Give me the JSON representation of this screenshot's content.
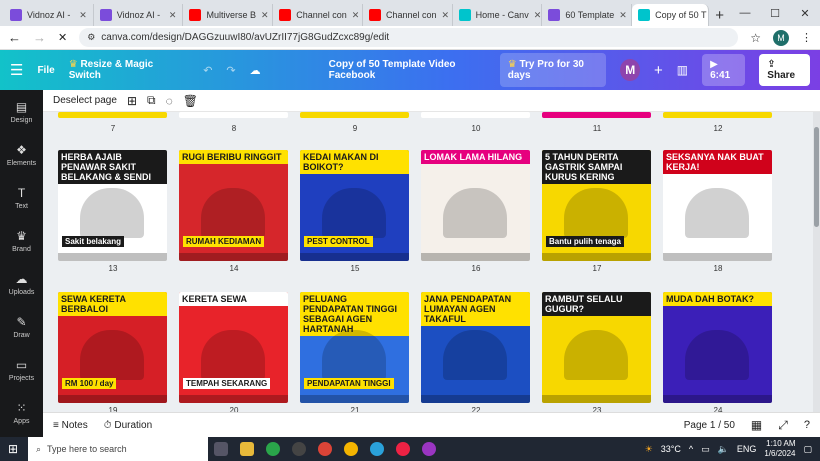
{
  "browser": {
    "tabs": [
      {
        "label": "Vidnoz AI -",
        "color": "#7b4cdb"
      },
      {
        "label": "Vidnoz AI -",
        "color": "#7b4cdb"
      },
      {
        "label": "Multiverse B",
        "color": "#ff0000"
      },
      {
        "label": "Channel con",
        "color": "#ff0000"
      },
      {
        "label": "Channel con",
        "color": "#ff0000"
      },
      {
        "label": "Home - Canv",
        "color": "#00c4cc"
      },
      {
        "label": "60 Template",
        "color": "#7b4cdb"
      },
      {
        "label": "Copy of 50 T",
        "color": "#00c4cc"
      }
    ],
    "url": "canva.com/design/DAGGzuuwI80/avUZrII77jG8GudZcxc89g/edit",
    "profile": "M"
  },
  "canva": {
    "file_label": "File",
    "resize_label": "Resize & Magic Switch",
    "doc_title": "Copy of 50 Template Video Facebook",
    "pro_label": "Try Pro for 30 days",
    "avatar": "M",
    "play_time": "6:41",
    "share_label": "Share",
    "deselect_label": "Deselect page"
  },
  "sidebar": [
    {
      "label": "Design",
      "icon": "design-icon"
    },
    {
      "label": "Elements",
      "icon": "elements-icon"
    },
    {
      "label": "Text",
      "icon": "text-icon"
    },
    {
      "label": "Brand",
      "icon": "brand-icon"
    },
    {
      "label": "Uploads",
      "icon": "uploads-icon"
    },
    {
      "label": "Draw",
      "icon": "draw-icon"
    },
    {
      "label": "Projects",
      "icon": "projects-icon"
    },
    {
      "label": "Apps",
      "icon": "apps-icon"
    }
  ],
  "pages": {
    "top_row": [
      "7",
      "8",
      "9",
      "10",
      "11",
      "12"
    ],
    "row1": [
      {
        "num": "13",
        "headline": "HERBA AJAIB PENAWAR SAKIT BELAKANG & SENDI",
        "caption": "Sakit belakang",
        "bg": "#ffffff",
        "accent": "#1a1a1a"
      },
      {
        "num": "14",
        "headline": "RUGI BERIBU RINGGIT",
        "caption": "RUMAH KEDIAMAN",
        "bg": "#d6262b",
        "accent": "#ffe100"
      },
      {
        "num": "15",
        "headline": "KEDAI MAKAN DI BOIKOT?",
        "caption": "PEST CONTROL",
        "bg": "#1f3fbf",
        "accent": "#ffe100"
      },
      {
        "num": "16",
        "headline": "LOMAK LAMA HILANG",
        "caption": "",
        "bg": "#f5f0ea",
        "accent": "#e6007e"
      },
      {
        "num": "17",
        "headline": "5 TAHUN DERITA GASTRIK SAMPAI KURUS KERING",
        "caption": "Bantu pulih tenaga",
        "bg": "#f7d800",
        "accent": "#1a1a1a"
      },
      {
        "num": "18",
        "headline": "SEKSANYA NAK BUAT KERJA!",
        "caption": "",
        "bg": "#ffffff",
        "accent": "#d0021b"
      }
    ],
    "row2": [
      {
        "num": "19",
        "headline": "SEWA KERETA BERBALOI",
        "caption": "RM 100 / day",
        "bg": "#d61f26",
        "accent": "#ffe100"
      },
      {
        "num": "20",
        "headline": "KERETA SEWA",
        "caption": "TEMPAH SEKARANG",
        "bg": "#e8232a",
        "accent": "#ffffff"
      },
      {
        "num": "21",
        "headline": "PELUANG PENDAPATAN TINGGI SEBAGAI AGEN HARTANAH",
        "caption": "PENDAPATAN TINGGI",
        "bg": "#2f6fe0",
        "accent": "#ffe100"
      },
      {
        "num": "22",
        "headline": "JANA PENDAPATAN LUMAYAN AGEN TAKAFUL",
        "caption": "",
        "bg": "#1c4fc2",
        "accent": "#ffe100"
      },
      {
        "num": "23",
        "headline": "RAMBUT SELALU GUGUR?",
        "caption": "",
        "bg": "#f7d800",
        "accent": "#1a1a1a"
      },
      {
        "num": "24",
        "headline": "MUDA DAH BOTAK?",
        "caption": "",
        "bg": "#3b1fb8",
        "accent": "#ffe100"
      }
    ],
    "bottom_row": [
      "19",
      "20",
      "21",
      "22",
      "23",
      "24"
    ]
  },
  "bottom": {
    "notes_label": "Notes",
    "duration_label": "Duration",
    "page_indicator": "Page 1 / 50"
  },
  "taskbar": {
    "search_placeholder": "Type here to search",
    "temp": "33°C",
    "lang": "ENG",
    "time": "1:10 AM",
    "date": "1/6/2024"
  }
}
